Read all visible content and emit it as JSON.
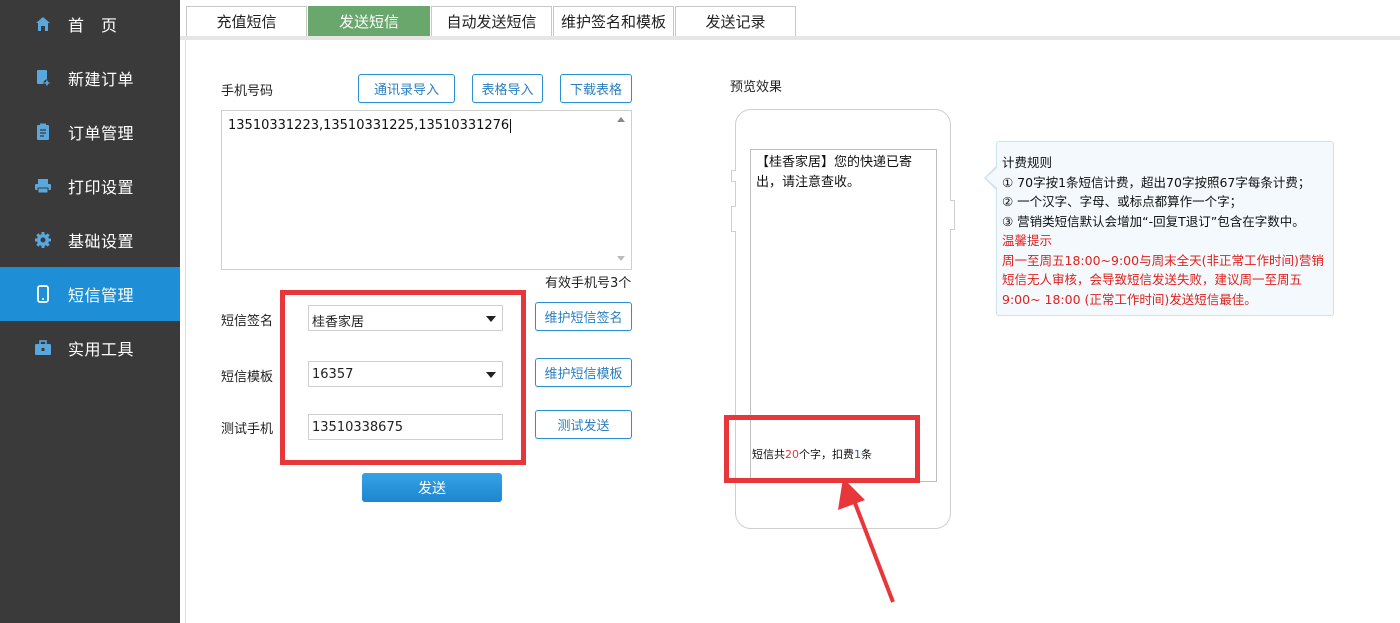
{
  "sidebar": {
    "items": [
      {
        "label": "首　页",
        "icon": "home-icon"
      },
      {
        "label": "新建订单",
        "icon": "new-order-icon"
      },
      {
        "label": "订单管理",
        "icon": "clipboard-icon"
      },
      {
        "label": "打印设置",
        "icon": "printer-icon"
      },
      {
        "label": "基础设置",
        "icon": "gear-icon"
      },
      {
        "label": "短信管理",
        "icon": "phone-icon"
      },
      {
        "label": "实用工具",
        "icon": "toolbox-icon"
      }
    ],
    "active_index": 5,
    "accent": "#1e8fd6"
  },
  "tabs": [
    {
      "label": "充值短信"
    },
    {
      "label": "发送短信"
    },
    {
      "label": "自动发送短信"
    },
    {
      "label": "维护签名和模板"
    },
    {
      "label": "发送记录"
    }
  ],
  "form": {
    "phone_label": "手机号码",
    "import_contacts_button": "通讯录导入",
    "import_table_button": "表格导入",
    "download_table_button": "下载表格",
    "phone_numbers_value": "13510331223,13510331225,13510331276",
    "valid_count_text": "有效手机号3个",
    "signature_label": "短信签名",
    "signature_value": "桂香家居",
    "maintain_signature_button": "维护短信签名",
    "template_label": "短信模板",
    "template_value": "16357",
    "maintain_template_button": "维护短信模板",
    "test_phone_label": "测试手机",
    "test_phone_value": "13510338675",
    "test_send_button": "测试发送",
    "send_button": "发送"
  },
  "preview": {
    "title": "预览效果",
    "message": "【桂香家居】您的快递已寄出，请注意查收。",
    "count_prefix": "短信共",
    "char_count": "20",
    "count_middle": "个字，扣费",
    "sms_count": "1",
    "count_suffix": "条"
  },
  "billing": {
    "title": "计费规则",
    "rule1": "① 70字按1条短信计费，超出70字按照67字每条计费；",
    "rule2": "② 一个汉字、字母、或标点都算作一个字；",
    "rule3": "③ 营销类短信默认会增加“-回复T退订”包含在字数中。",
    "tip_title": "温馨提示",
    "tip_body": "周一至周五18:00~9:00与周末全天(非正常工作时间)营销短信无人审核，会导致短信发送失败，建议周一至周五9:00~ 18:00 (正常工作时间)发送短信最佳。"
  },
  "colors": {
    "sidebar_bg": "#3a3a3a",
    "active_tab": "#6aa76c",
    "highlight_red": "#e8373b",
    "warning_text": "#e0211e"
  }
}
